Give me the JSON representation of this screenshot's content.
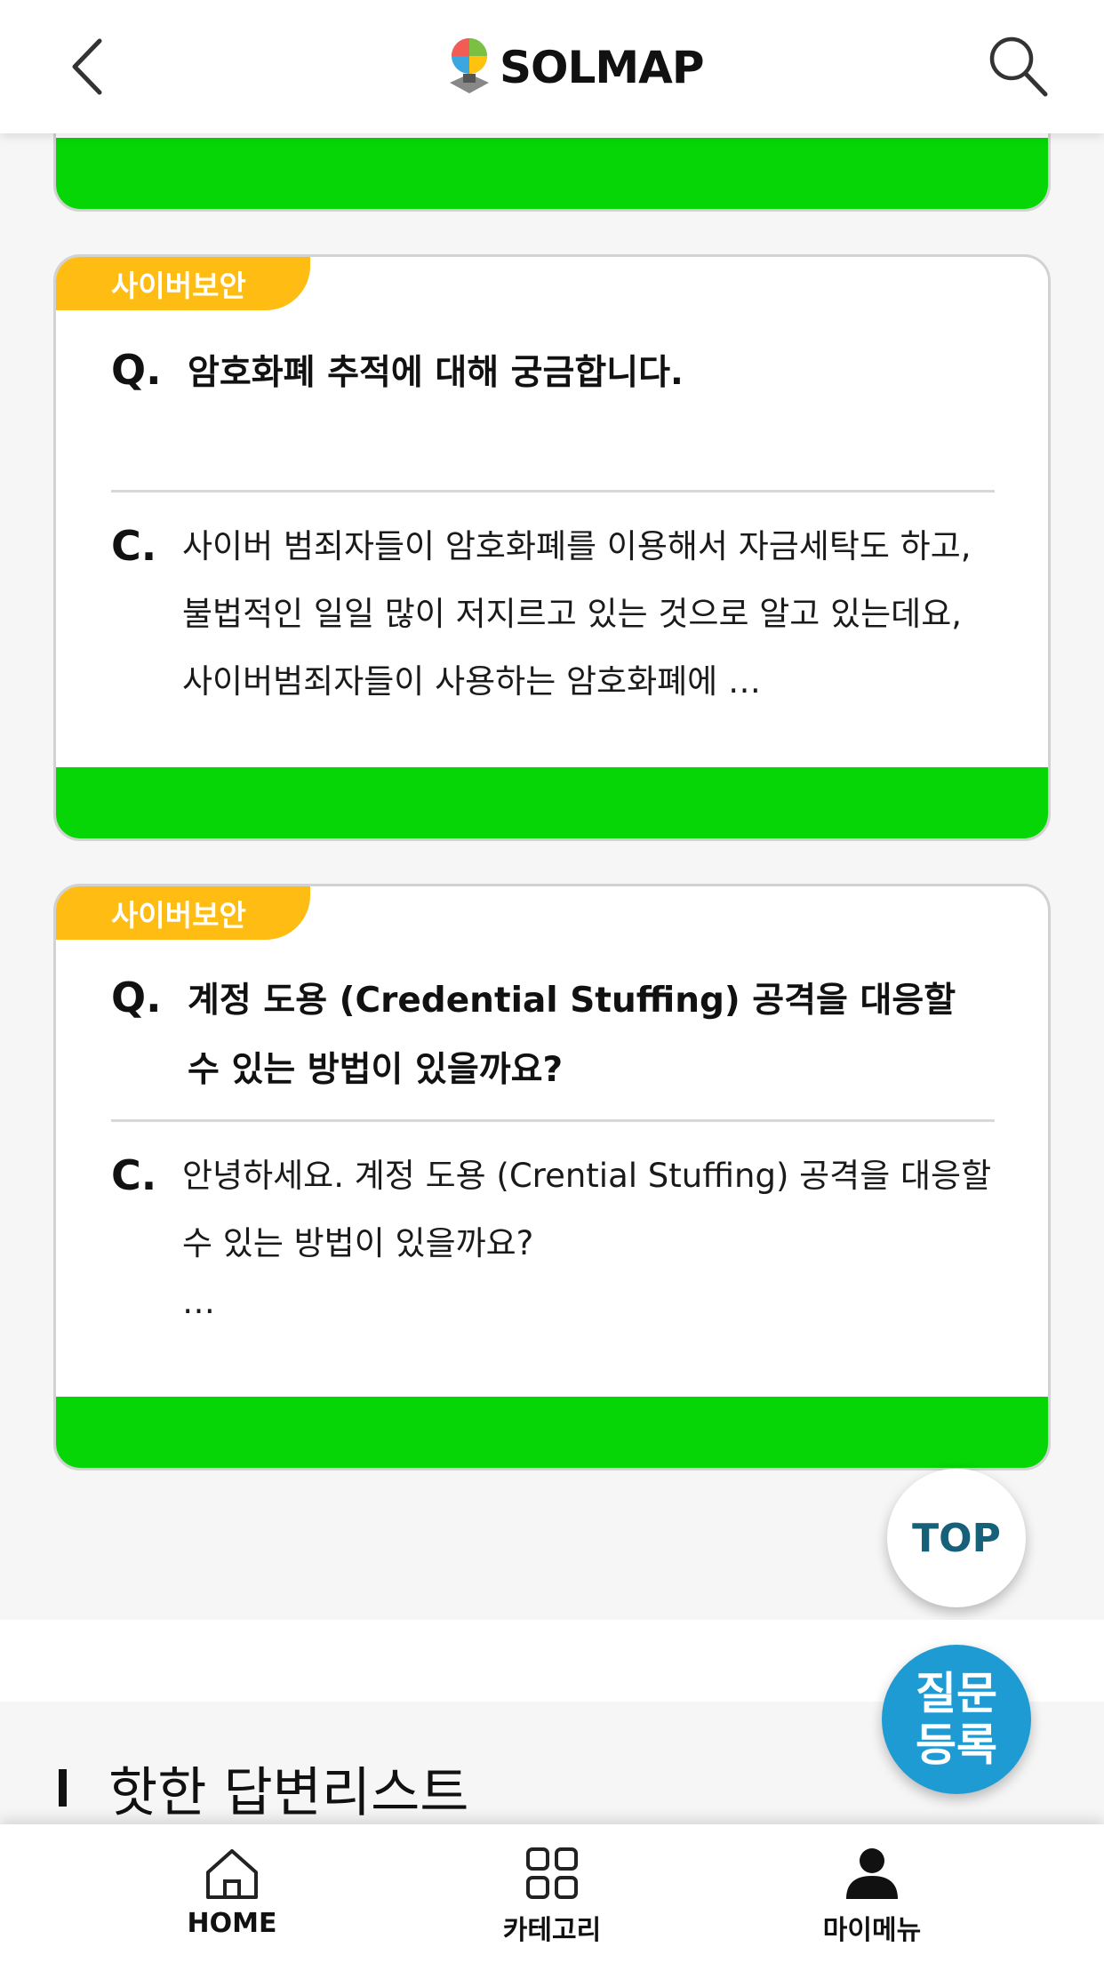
{
  "header": {
    "app_name": "SOLMAP",
    "back_icon": "chevron-left-icon",
    "search_icon": "search-icon"
  },
  "cards": [
    {
      "category": "사이버보안",
      "q_prefix": "Q.",
      "question": "암호화폐 추적에 대해 궁금합니다.",
      "c_prefix": "C.",
      "content": "사이버 범죄자들이 암호화폐를 이용해서 자금세탁도 하고, 불법적인 일일 많이 저지르고 있는 것으로 알고 있는데요, 사이버범죄자들이 사용하는 암호화폐에 …",
      "content_more": ""
    },
    {
      "category": "사이버보안",
      "q_prefix": "Q.",
      "question": "계정 도용 (Credential Stuffing) 공격을 대응할 수 있는 방법이 있을까요?",
      "c_prefix": "C.",
      "content": "안녕하세요. 계정 도용 (Crential Stuffing) 공격을 대응할 수 있는 방법이 있을까요?",
      "content_more": "…"
    }
  ],
  "top_button": "TOP",
  "ask_button": {
    "line1": "질문",
    "line2": "등록"
  },
  "section": {
    "title": "핫한 답변리스트"
  },
  "bottom_nav": [
    {
      "label": "HOME",
      "icon": "home-icon"
    },
    {
      "label": "카테고리",
      "icon": "grid-icon"
    },
    {
      "label": "마이메뉴",
      "icon": "person-icon"
    }
  ],
  "colors": {
    "accent_green": "#06d506",
    "tag_yellow": "#ffbc12",
    "top_text": "#17607a",
    "ask_blue": "#1f9bd4"
  }
}
